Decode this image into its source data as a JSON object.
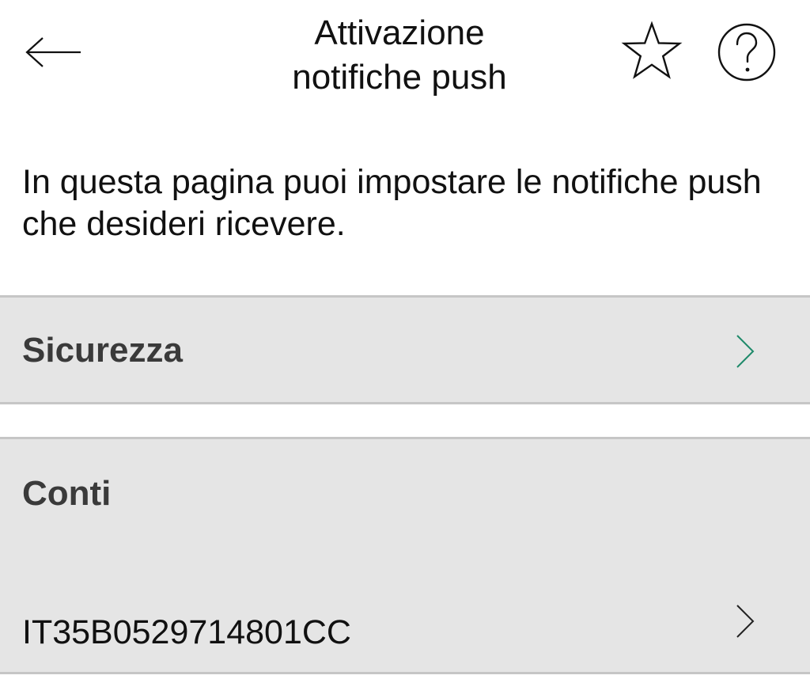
{
  "header": {
    "title_line1": "Attivazione",
    "title_line2": "notifiche push"
  },
  "intro": {
    "text": "In questa pagina puoi impostare le notifiche push che desideri ricevere."
  },
  "sections": {
    "security": {
      "title": "Sicurezza",
      "chevron_color": "#1f8a6a"
    },
    "accounts": {
      "title": "Conti",
      "items": [
        {
          "iban": "IT35B0529714801CC"
        }
      ]
    }
  },
  "icons": {
    "back": "arrow-left-icon",
    "favorite": "star-outline-icon",
    "help": "question-circle-icon",
    "chevron": "chevron-right-icon"
  }
}
